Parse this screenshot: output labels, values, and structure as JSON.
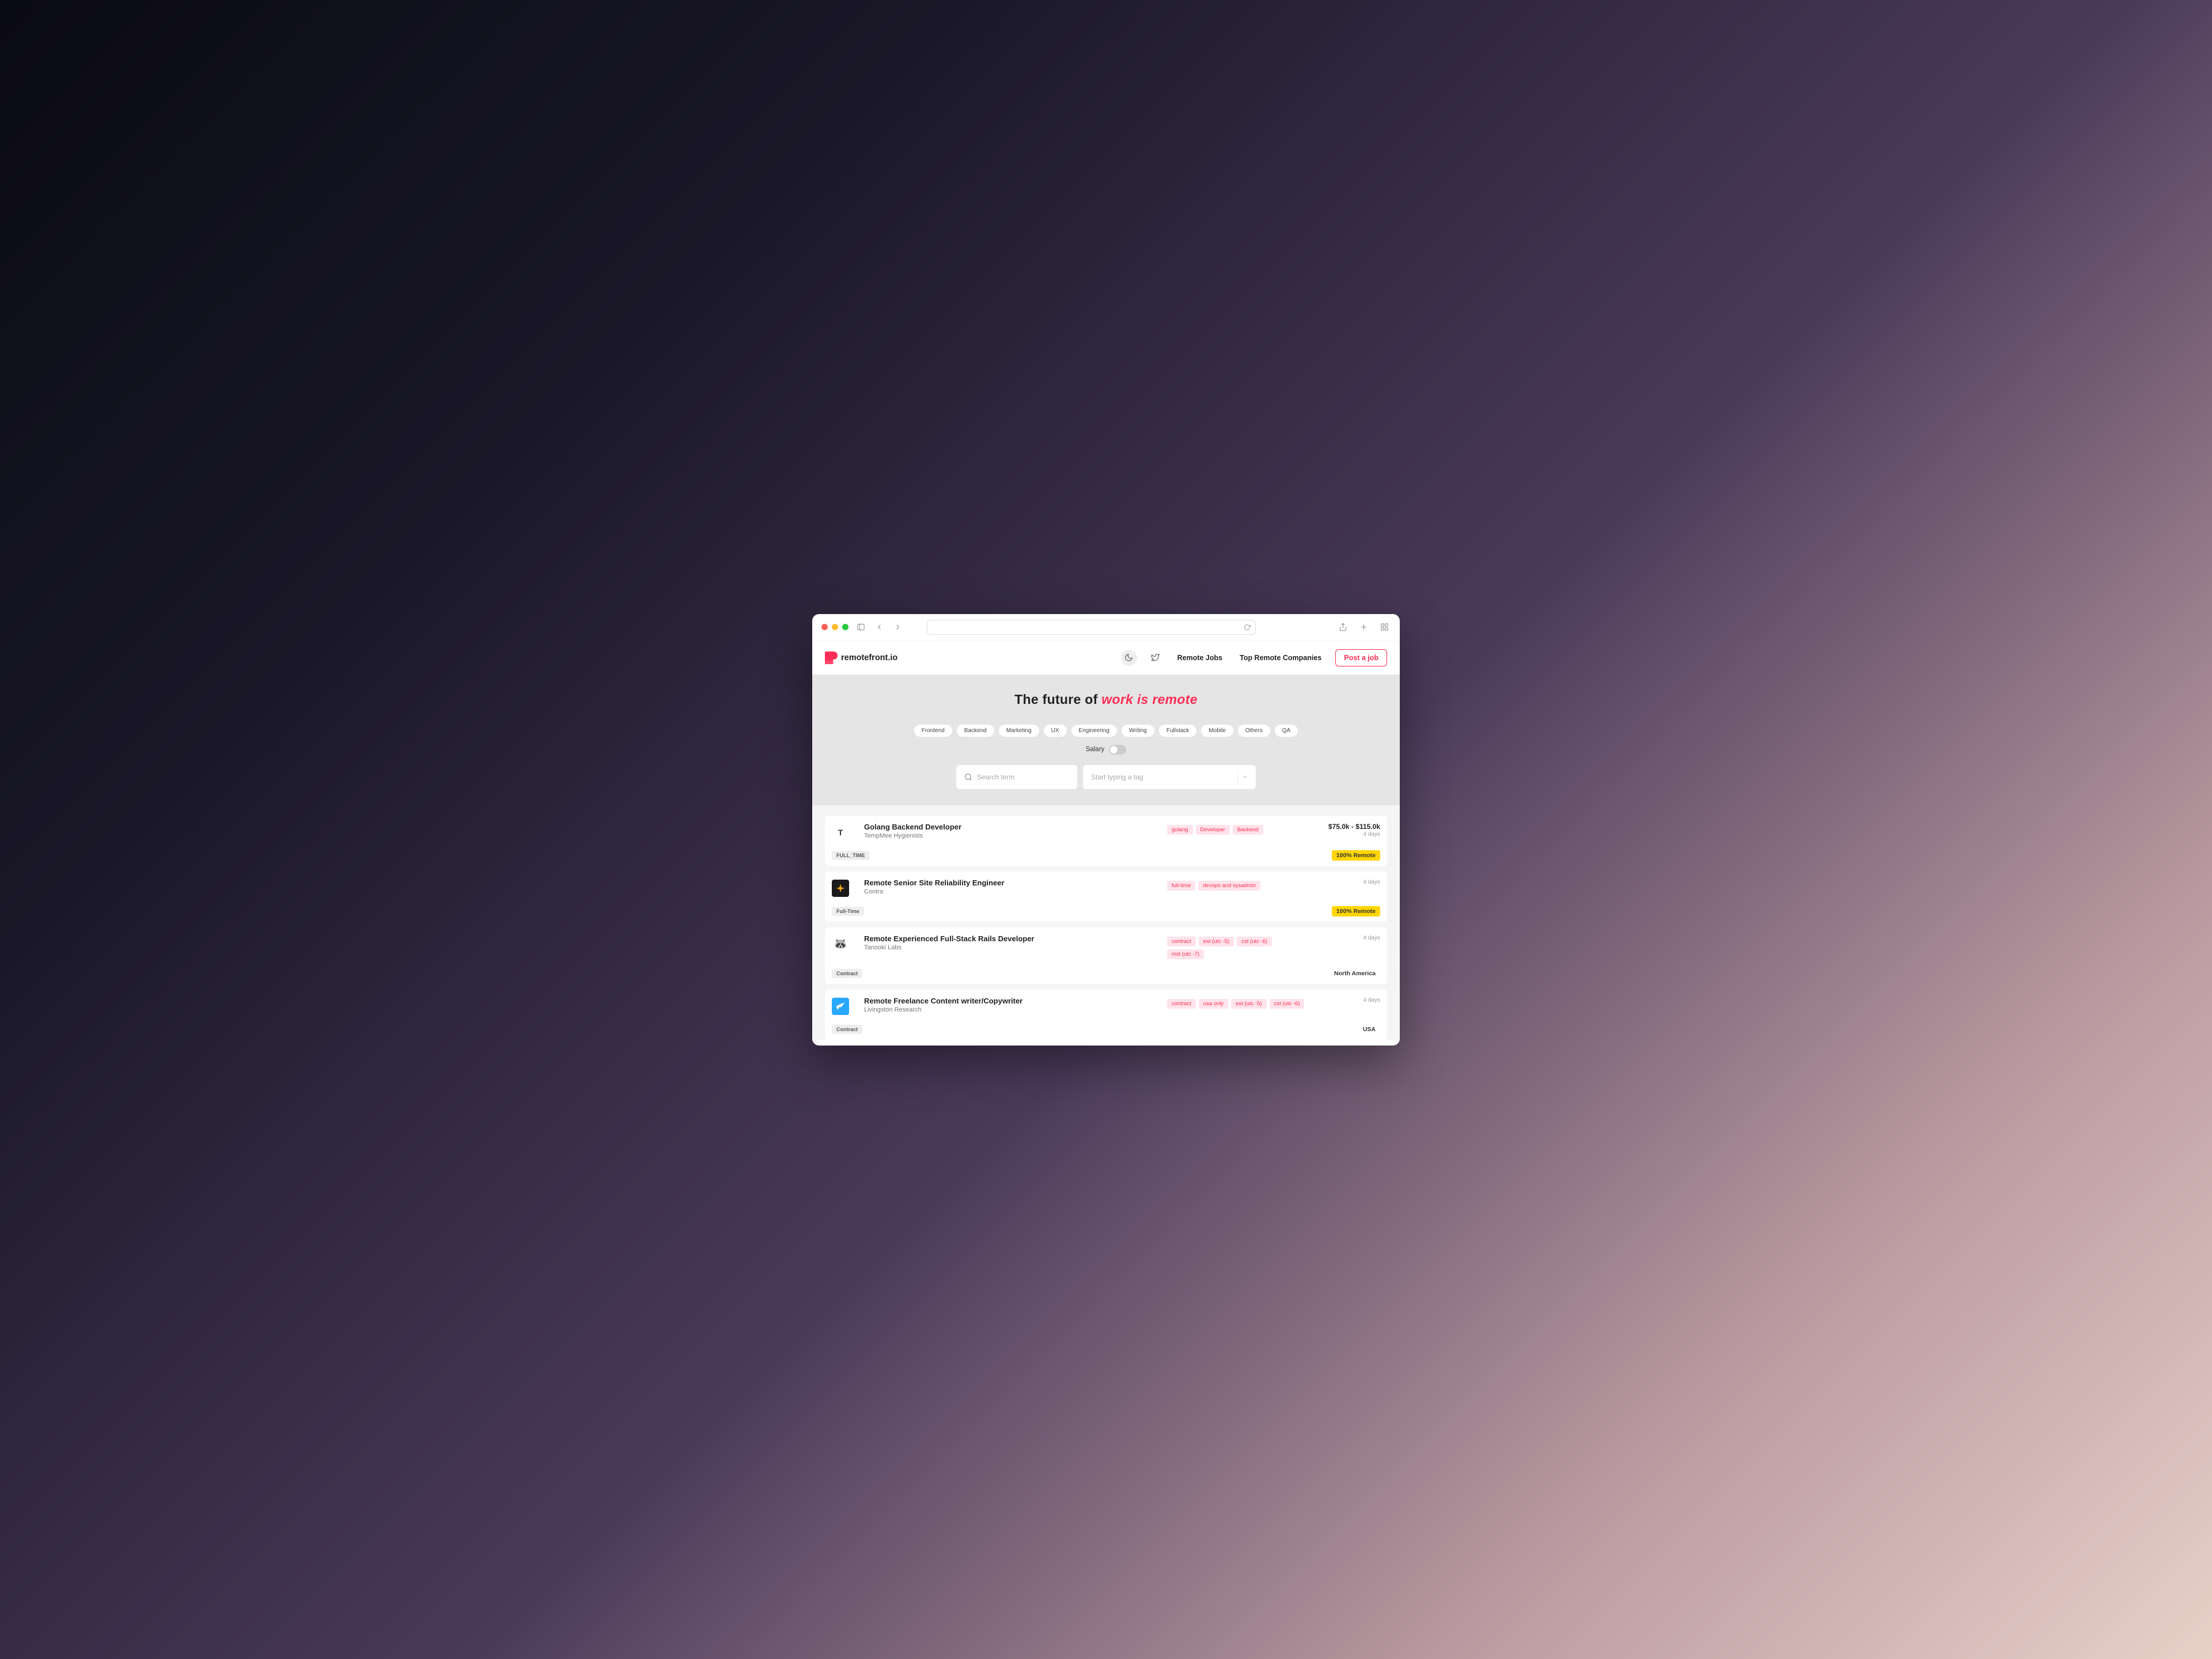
{
  "header": {
    "brand": "remotefront.io",
    "nav": {
      "remote_jobs": "Remote Jobs",
      "top_companies": "Top Remote Companies"
    },
    "post_btn": "Post a job"
  },
  "hero": {
    "title_prefix": "The future of ",
    "title_accent": "work is remote",
    "categories": [
      "Frontend",
      "Backend",
      "Marketing",
      "UX",
      "Engineering",
      "Writing",
      "Fullstack",
      "Mobile",
      "Others",
      "QA"
    ],
    "salary_label": "Salary",
    "search_placeholder": "Search term",
    "tag_placeholder": "Start typing a tag"
  },
  "jobs": [
    {
      "logo": {
        "kind": "letter",
        "text": "T"
      },
      "title": "Golang Backend Developer",
      "company": "TempMee Hygienists",
      "tags": [
        "golang",
        "Developer",
        "Backend"
      ],
      "salary": "$75.0k - $115.0k",
      "age": "4 days",
      "type": "FULL_TIME",
      "location": "100% Remote",
      "remote": true
    },
    {
      "logo": {
        "kind": "compass"
      },
      "title": "Remote Senior Site Reliability Engineer",
      "company": "Contra",
      "tags": [
        "full-time",
        "devops and sysadmin"
      ],
      "salary": "",
      "age": "4 days",
      "type": "Full-Time",
      "location": "100% Remote",
      "remote": true
    },
    {
      "logo": {
        "kind": "tanooki"
      },
      "title": "Remote Experienced Full-Stack Rails Developer",
      "company": "Tanooki Labs",
      "tags": [
        "contract",
        "est (utc -5)",
        "cst (utc -6)",
        "mst (utc -7)"
      ],
      "salary": "",
      "age": "4 days",
      "type": "Contract",
      "location": "North America",
      "remote": false
    },
    {
      "logo": {
        "kind": "bird"
      },
      "title": "Remote Freelance Content writer/Copywriter",
      "company": "Livingston Research",
      "tags": [
        "contract",
        "usa only",
        "est (utc -5)",
        "cst (utc -6)"
      ],
      "salary": "",
      "age": "4 days",
      "type": "Contract",
      "location": "USA",
      "remote": false
    }
  ]
}
